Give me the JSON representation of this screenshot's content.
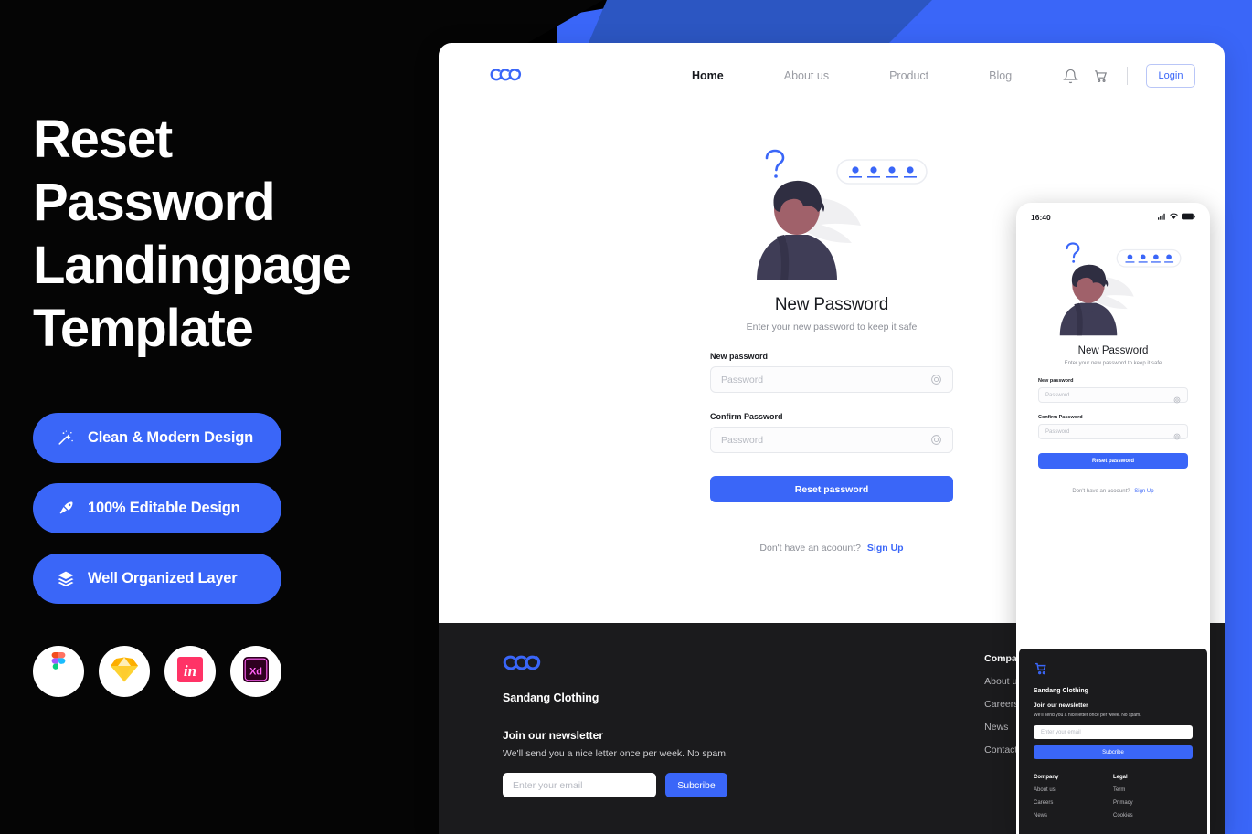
{
  "hero": {
    "title_lines": [
      "Reset",
      "Password",
      "Landingpage",
      "Template"
    ],
    "accent_color": "#3a66f8",
    "background_color": "#050505"
  },
  "features": [
    {
      "icon": "magic-wand-icon",
      "label": "Clean & Modern  Design"
    },
    {
      "icon": "pen-nib-icon",
      "label": "100% Editable Design"
    },
    {
      "icon": "layers-icon",
      "label": "Well Organized Layer"
    }
  ],
  "app_badges": [
    {
      "icon": "figma-icon",
      "label": "Figma"
    },
    {
      "icon": "sketch-icon",
      "label": "Sketch"
    },
    {
      "icon": "invision-icon",
      "label": "InVision"
    },
    {
      "icon": "adobexd-icon",
      "label": "Adobe XD"
    }
  ],
  "desktop": {
    "nav": {
      "logo": "sandang-logo-icon",
      "menu": [
        {
          "label": "Home",
          "active": true
        },
        {
          "label": "About us",
          "active": false
        },
        {
          "label": "Product",
          "active": false
        },
        {
          "label": "Blog",
          "active": false
        }
      ],
      "bell_icon": "bell-icon",
      "cart_icon": "cart-icon",
      "login_label": "Login"
    },
    "form": {
      "heading": "New Password",
      "subheading": "Enter your new password to keep it safe",
      "field_new_label": "New password",
      "field_new_placeholder": "Password",
      "field_confirm_label": "Confirm Password",
      "field_confirm_placeholder": "Password",
      "submit_label": "Reset password",
      "footer_text": "Don't have an acoount?",
      "footer_link": "Sign Up"
    },
    "footer": {
      "brand": "Sandang Clothing",
      "newsletter_heading": "Join our newsletter",
      "newsletter_text": "We'll send you a nice letter once per week. No spam.",
      "email_placeholder": "Enter your email",
      "subscribe_label": "Subcribe",
      "company_heading": "Company",
      "company_links": [
        "About us",
        "Careers",
        "News",
        "Contact"
      ]
    }
  },
  "phone": {
    "status": {
      "time": "16:40",
      "signal_icon": "signal-icon",
      "wifi_icon": "wifi-icon",
      "battery_icon": "battery-icon"
    },
    "form": {
      "heading": "New Password",
      "subheading": "Enter your new password to keep it safe",
      "field_new_label": "New password",
      "field_new_placeholder": "Password",
      "field_confirm_label": "Confirm Password",
      "field_confirm_placeholder": "Password",
      "submit_label": "Reset password",
      "footer_text": "Don't have an acoount?",
      "footer_link": "Sign Up"
    },
    "footer": {
      "cart_icon": "cart-icon",
      "brand": "Sandang Clothing",
      "newsletter_heading": "Join our newsletter",
      "newsletter_text": "We'll send you a nice letter once per week. No spam.",
      "email_placeholder": "Enter your email",
      "subscribe_label": "Subcribe",
      "company_heading": "Company",
      "company_links": [
        "About us",
        "Careers",
        "News"
      ],
      "legal_heading": "Legal",
      "legal_links": [
        "Term",
        "Primacy",
        "Cookies"
      ]
    }
  }
}
